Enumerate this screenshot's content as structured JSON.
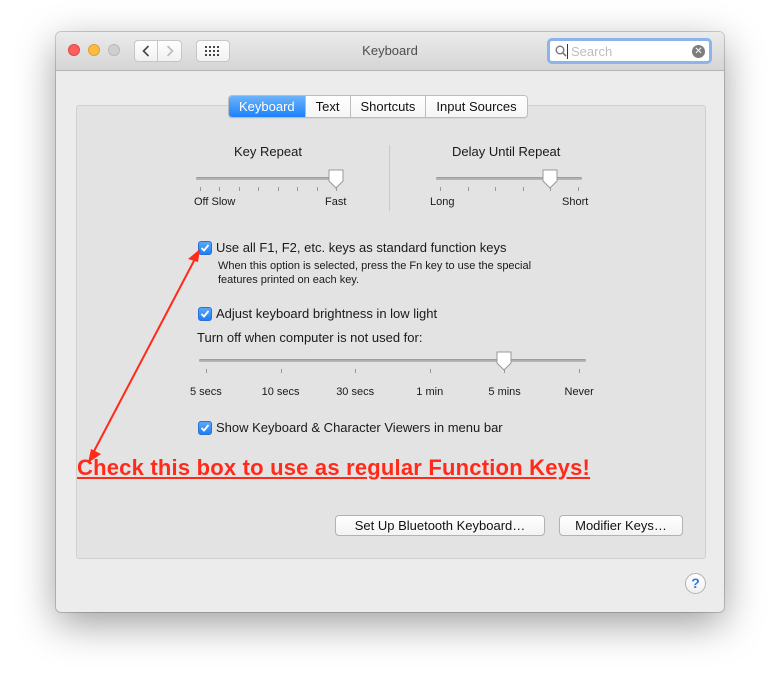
{
  "window": {
    "title": "Keyboard"
  },
  "search": {
    "placeholder": "Search",
    "value": ""
  },
  "tabs": [
    {
      "label": "Keyboard",
      "active": true
    },
    {
      "label": "Text",
      "active": false
    },
    {
      "label": "Shortcuts",
      "active": false
    },
    {
      "label": "Input Sources",
      "active": false
    }
  ],
  "key_repeat": {
    "title": "Key Repeat",
    "min_label": "Off Slow",
    "max_label": "Fast",
    "level": 1.0,
    "tick_count": 8
  },
  "delay_until_repeat": {
    "title": "Delay Until Repeat",
    "min_label": "Long",
    "max_label": "Short",
    "level": 0.8,
    "tick_count": 6
  },
  "fn_keys": {
    "checked": true,
    "label": "Use all F1, F2, etc. keys as standard function keys",
    "desc_line1": "When this option is selected, press the Fn key to use the special",
    "desc_line2": "features printed on each key."
  },
  "brightness": {
    "checked": true,
    "label": "Adjust keyboard brightness in low light"
  },
  "turn_off": {
    "label": "Turn off when computer is not used for:",
    "options": [
      "5 secs",
      "10 secs",
      "30 secs",
      "1 min",
      "5 mins",
      "Never"
    ],
    "selected": "5 mins"
  },
  "viewers": {
    "checked": true,
    "label": "Show Keyboard & Character Viewers in menu bar"
  },
  "buttons": {
    "bluetooth": "Set Up Bluetooth Keyboard…",
    "modifier": "Modifier Keys…",
    "help": "?"
  },
  "annotation": {
    "text": "Check this box to use as regular Function Keys!",
    "color": "#ff2a1a"
  },
  "colors": {
    "accent": "#1a82fb",
    "close": "#fc605c",
    "minimize": "#fdbc40"
  }
}
